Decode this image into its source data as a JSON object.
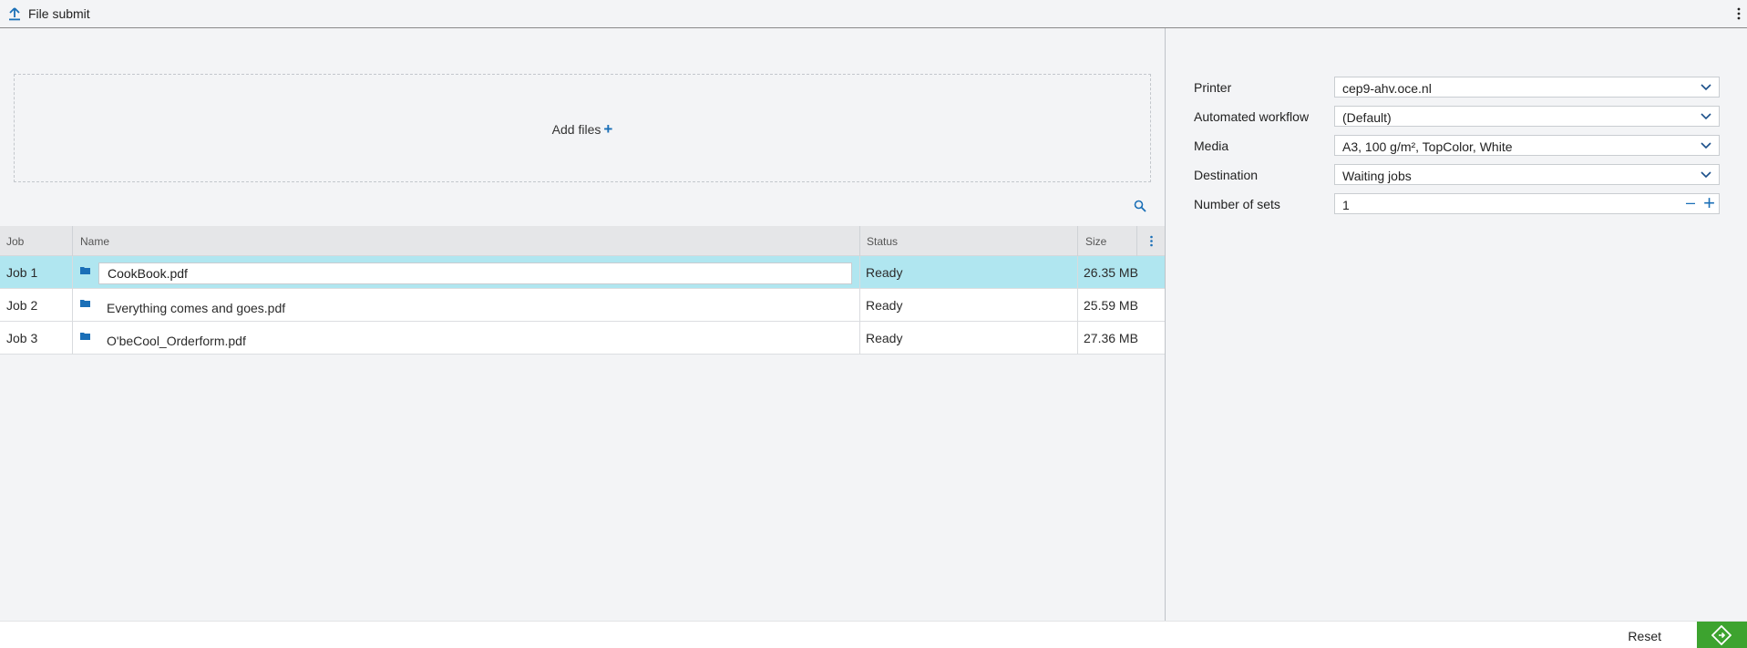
{
  "header": {
    "title": "File submit",
    "icon": "upload-icon",
    "menu_icon": "more-vert-icon"
  },
  "dropzone": {
    "label": "Add files",
    "plus": "+"
  },
  "table": {
    "columns": {
      "job": "Job",
      "name": "Name",
      "status": "Status",
      "size": "Size"
    },
    "rows": [
      {
        "job": "Job 1",
        "name": "CookBook.pdf",
        "status": "Ready",
        "size": "26.35 MB",
        "selected": true
      },
      {
        "job": "Job 2",
        "name": "Everything comes and goes.pdf",
        "status": "Ready",
        "size": "25.59 MB",
        "selected": false
      },
      {
        "job": "Job 3",
        "name": "O'beCool_Orderform.pdf",
        "status": "Ready",
        "size": "27.36 MB",
        "selected": false
      }
    ]
  },
  "settings": {
    "printer": {
      "label": "Printer",
      "value": "cep9-ahv.oce.nl"
    },
    "workflow": {
      "label": "Automated workflow",
      "value": "(Default)"
    },
    "media": {
      "label": "Media",
      "value": "A3, 100 g/m², TopColor, White"
    },
    "destination": {
      "label": "Destination",
      "value": "Waiting jobs"
    },
    "sets": {
      "label": "Number of sets",
      "value": "1",
      "minus": "–",
      "plus": "+"
    }
  },
  "footer": {
    "reset_label": "Reset",
    "submit_icon": "print-submit-icon"
  },
  "colors": {
    "accent": "#1a6fb7",
    "selected_row": "#b0e6f0",
    "submit": "#3da32f"
  }
}
